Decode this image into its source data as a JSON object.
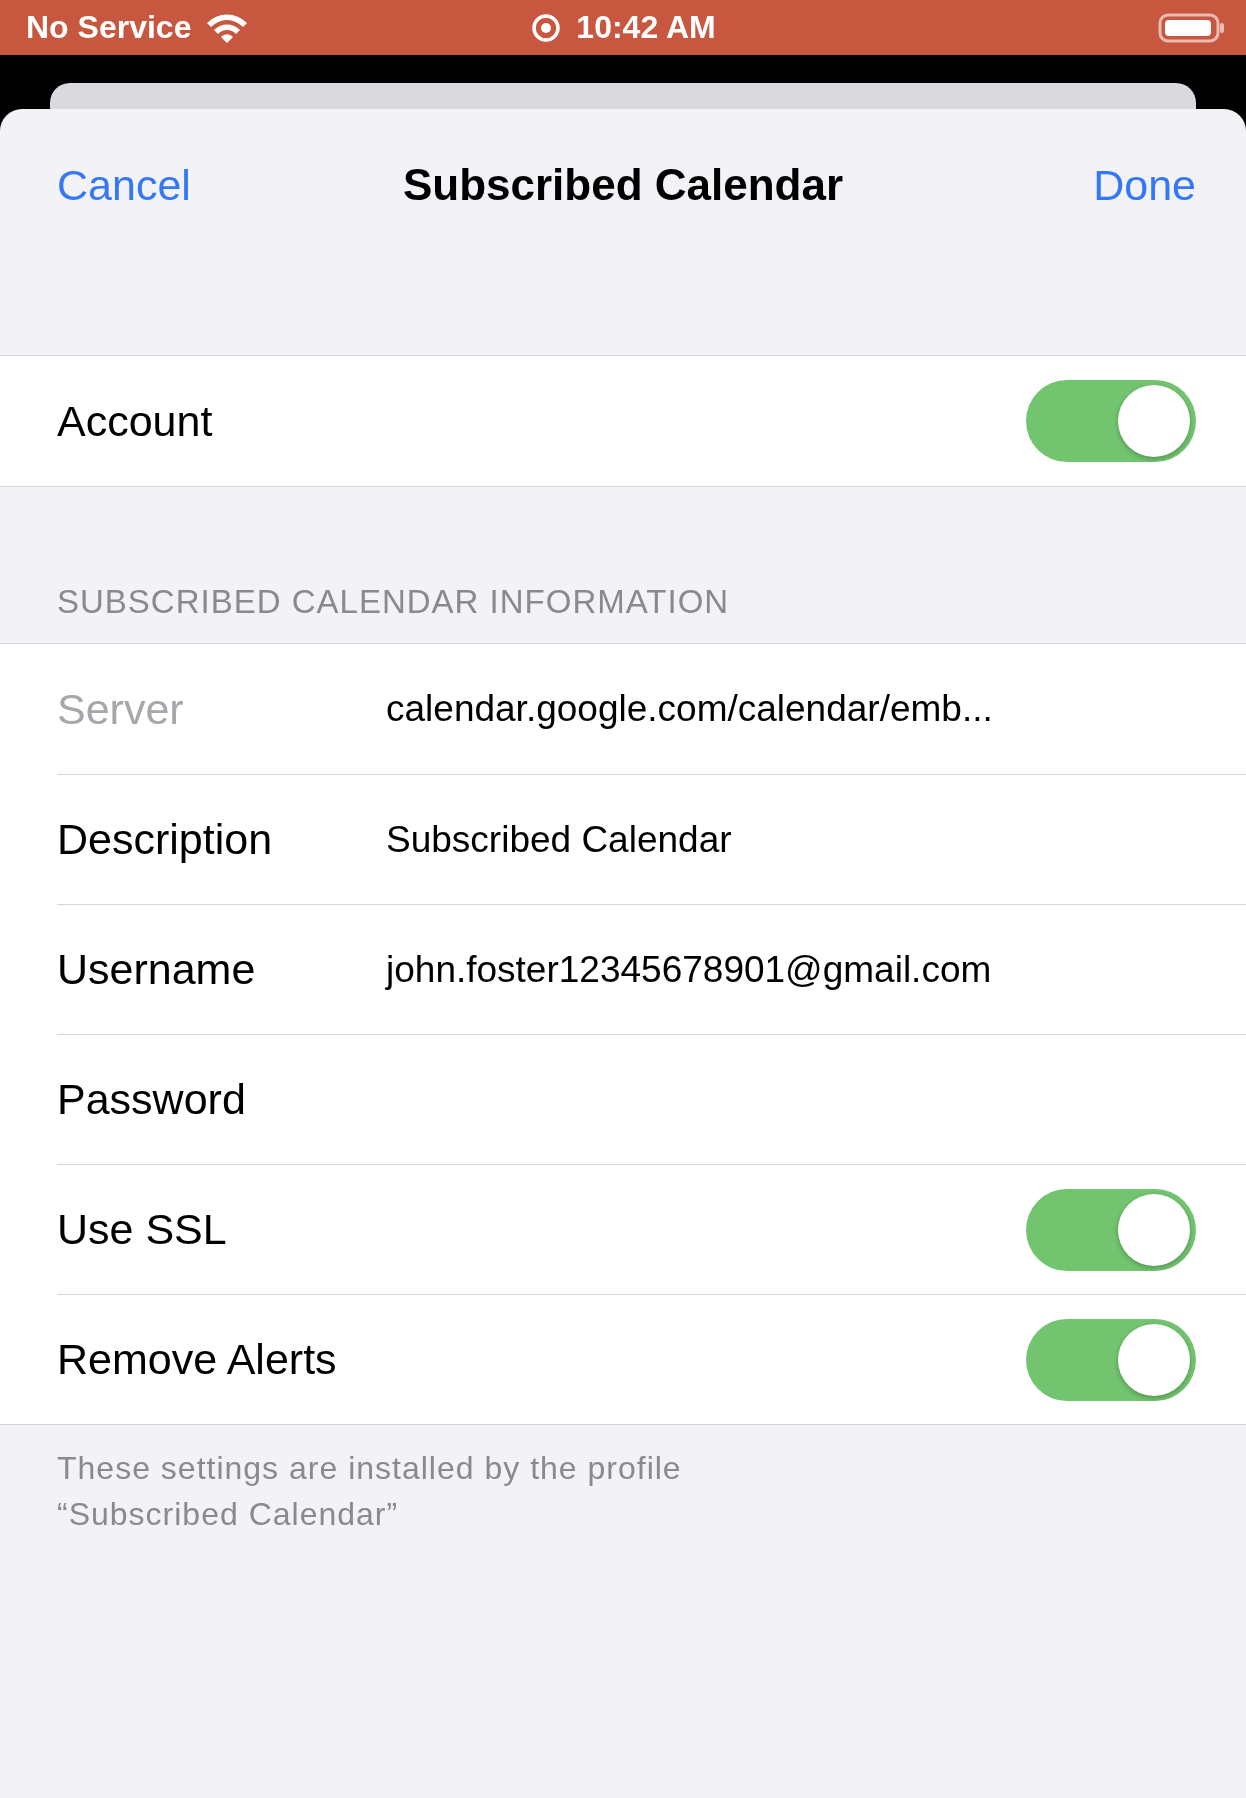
{
  "status_bar": {
    "carrier": "No Service",
    "time": "10:42 AM"
  },
  "nav": {
    "cancel": "Cancel",
    "title": "Subscribed Calendar",
    "done": "Done"
  },
  "account": {
    "label": "Account",
    "on": true
  },
  "section_header": "SUBSCRIBED CALENDAR INFORMATION",
  "rows": [
    {
      "kind": "field",
      "label": "Server",
      "disabled": true,
      "value": "calendar.google.com/calendar/emb..."
    },
    {
      "kind": "field",
      "label": "Description",
      "disabled": false,
      "value": "Subscribed Calendar"
    },
    {
      "kind": "field",
      "label": "Username",
      "disabled": false,
      "value": "john.foster12345678901@gmail.com"
    },
    {
      "kind": "field",
      "label": "Password",
      "disabled": false
    },
    {
      "kind": "toggle",
      "label": "Use SSL",
      "on": true
    },
    {
      "kind": "toggle",
      "label": "Remove Alerts",
      "on": true
    }
  ],
  "footer": "These settings are installed by the profile “Subscribed Calendar”"
}
